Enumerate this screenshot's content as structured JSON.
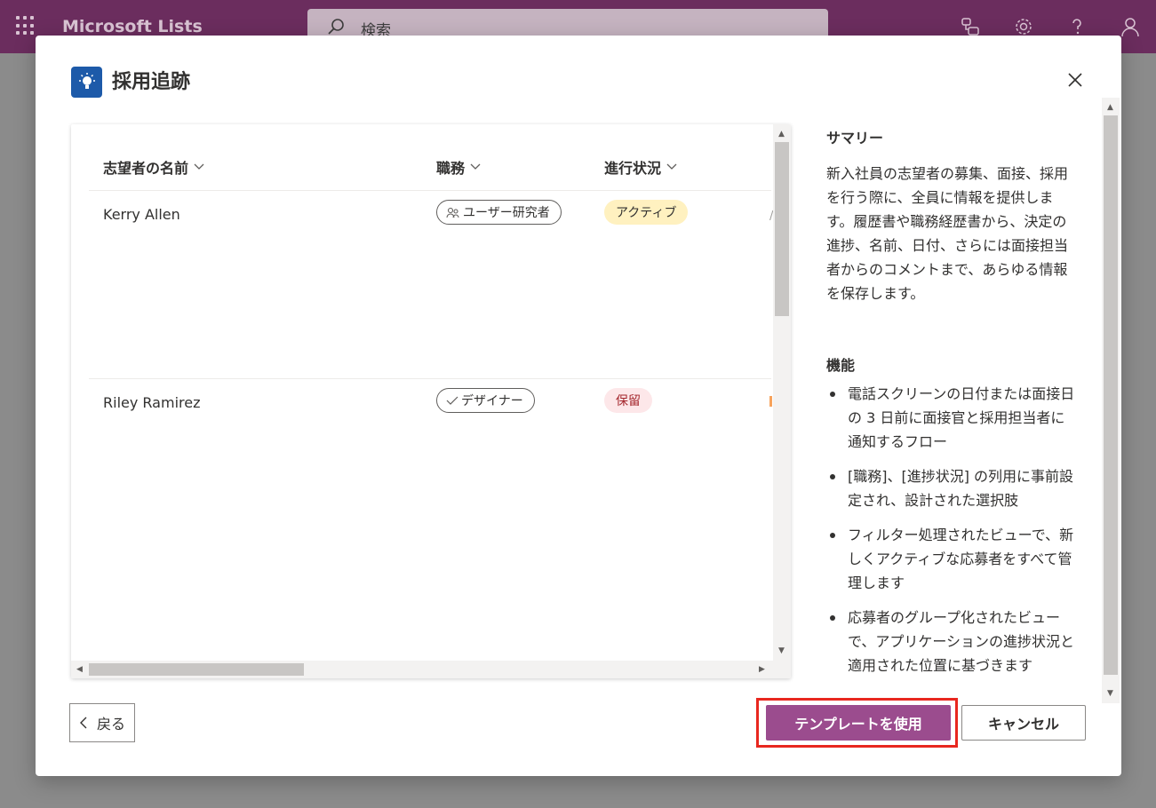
{
  "appbar": {
    "title": "Microsoft Lists",
    "search_placeholder": "検索"
  },
  "dialog": {
    "title": "採用追跡",
    "icon": "lightbulb-icon"
  },
  "preview": {
    "columns": [
      "志望者の名前",
      "職務",
      "進行状況"
    ],
    "rows": [
      {
        "name": "Kerry Allen",
        "role": "ユーザー研究者",
        "role_icon": "people-icon",
        "status": "アクティブ",
        "status_color": "#fff1c0"
      },
      {
        "name": "Riley Ramirez",
        "role": "デザイナー",
        "role_icon": "check-icon",
        "status": "保留",
        "status_color": "#fde7e9"
      }
    ]
  },
  "details": {
    "summary_title": "サマリー",
    "summary_text": "新入社員の志望者の募集、面接、採用を行う際に、全員に情報を提供します。履歴書や職務経歴書から、決定の進捗、名前、日付、さらには面接担当者からのコメントまで、あらゆる情報を保存します。",
    "features_title": "機能",
    "features": [
      "電話スクリーンの日付または面接日の 3 日前に面接官と採用担当者に通知するフロー",
      "[職務]、[進捗状況] の列用に事前設定され、設計された選択肢",
      "フィルター処理されたビューで、新しくアクティブな応募者をすべて管理します",
      "応募者のグループ化されたビューで、アプリケーションの進捗状況と適用された位置に基づきます"
    ]
  },
  "footer": {
    "back_label": "戻る",
    "use_template_label": "テンプレートを使用",
    "cancel_label": "キャンセル"
  },
  "colors": {
    "appbar": "#6b2d5e",
    "primary": "#9b4c8e",
    "highlight": "#e8271f"
  }
}
